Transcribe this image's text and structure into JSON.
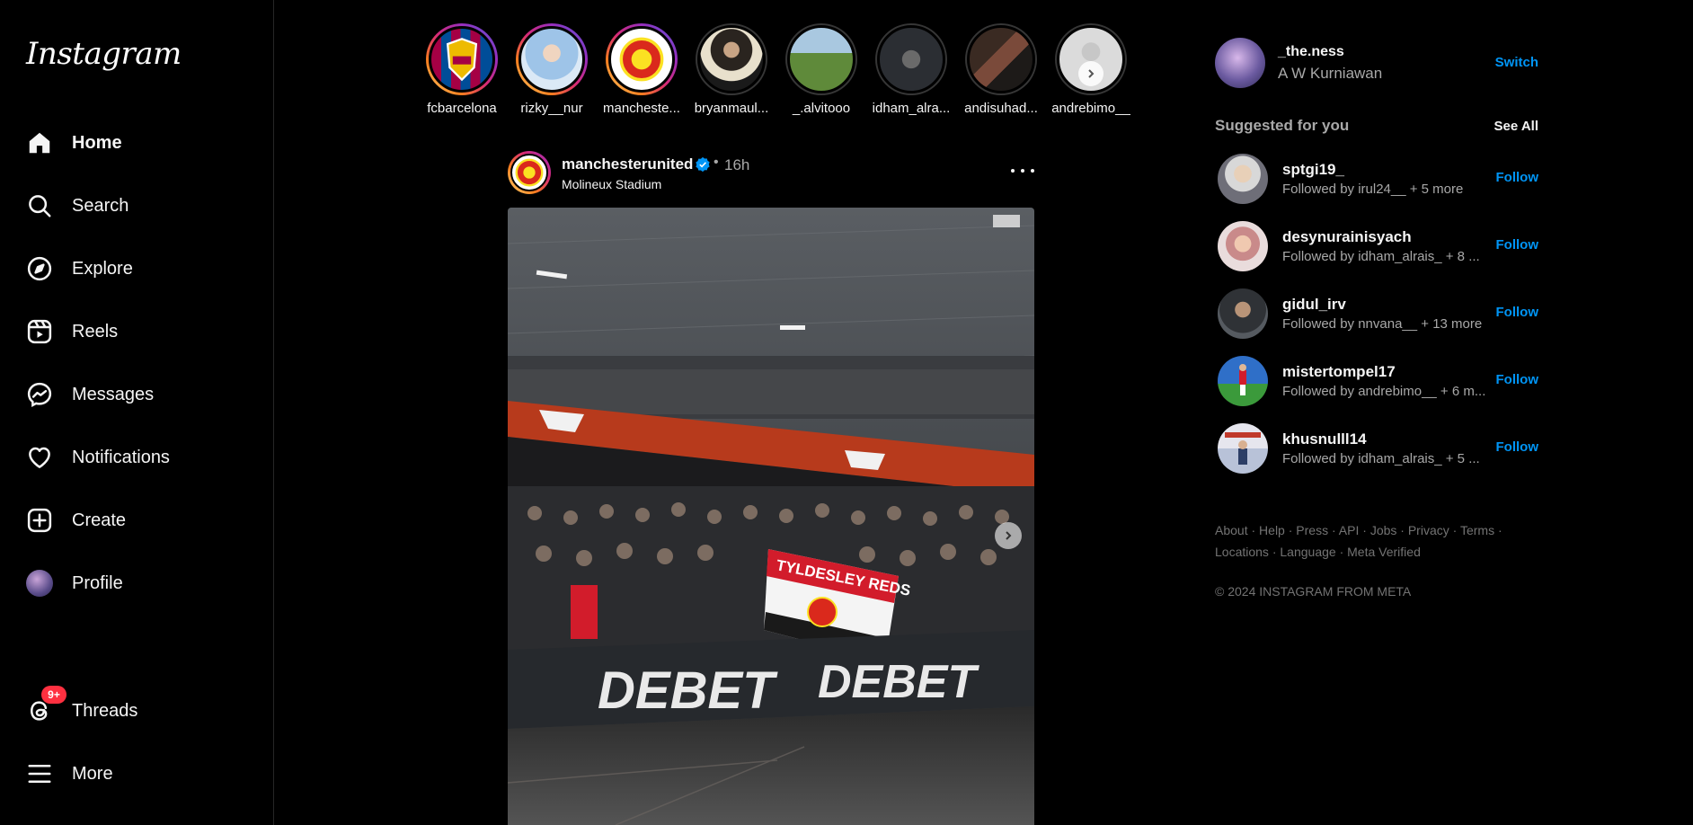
{
  "sidebar": {
    "logo": "Instagram",
    "items": [
      {
        "label": "Home",
        "icon": "home-icon"
      },
      {
        "label": "Search",
        "icon": "search-icon"
      },
      {
        "label": "Explore",
        "icon": "compass-icon"
      },
      {
        "label": "Reels",
        "icon": "reels-icon"
      },
      {
        "label": "Messages",
        "icon": "messenger-icon"
      },
      {
        "label": "Notifications",
        "icon": "heart-icon"
      },
      {
        "label": "Create",
        "icon": "plus-square-icon"
      },
      {
        "label": "Profile",
        "icon": "avatar"
      },
      {
        "label": "Threads",
        "icon": "threads-icon",
        "badge": "9+"
      },
      {
        "label": "More",
        "icon": "hamburger-icon"
      }
    ]
  },
  "stories": [
    {
      "name": "fcbarcelona",
      "seen": false
    },
    {
      "name": "rizky__nur",
      "seen": false
    },
    {
      "name": "mancheste...",
      "seen": false
    },
    {
      "name": "bryanmaul...",
      "seen": true
    },
    {
      "name": "_.alvitooo",
      "seen": true
    },
    {
      "name": "idham_alra...",
      "seen": true
    },
    {
      "name": "andisuhad...",
      "seen": true
    },
    {
      "name": "andrebimo__",
      "seen": true
    }
  ],
  "post": {
    "username": "manchesterunited",
    "verified": true,
    "separator": "•",
    "time": "16h",
    "location": "Molineux Stadium",
    "image_texts": {
      "banner": "TYLDESLEY REDS",
      "sponsor": "DEBET"
    }
  },
  "current_user": {
    "username": "_the.ness",
    "full_name": "A W Kurniawan",
    "switch_label": "Switch"
  },
  "suggestions": {
    "title": "Suggested for you",
    "see_all": "See All",
    "follow_label": "Follow",
    "items": [
      {
        "username": "sptgi19_",
        "subtitle": "Followed by irul24__ + 5 more"
      },
      {
        "username": "desynurainisyach",
        "subtitle": "Followed by idham_alrais_ + 8 ..."
      },
      {
        "username": "gidul_irv",
        "subtitle": "Followed by nnvana__ + 13 more"
      },
      {
        "username": "mistertompel17",
        "subtitle": "Followed by andrebimo__ + 6 m..."
      },
      {
        "username": "khusnulll14",
        "subtitle": "Followed by idham_alrais_ + 5 ..."
      }
    ]
  },
  "footer": {
    "links": [
      "About",
      "Help",
      "Press",
      "API",
      "Jobs",
      "Privacy",
      "Terms",
      "Locations",
      "Language",
      "Meta Verified"
    ],
    "separator": "·",
    "copyright": "© 2024 INSTAGRAM FROM META"
  },
  "colors": {
    "background": "#000000",
    "accent": "#0095f6",
    "badge": "#ff3040",
    "muted": "#a8a8a8"
  }
}
